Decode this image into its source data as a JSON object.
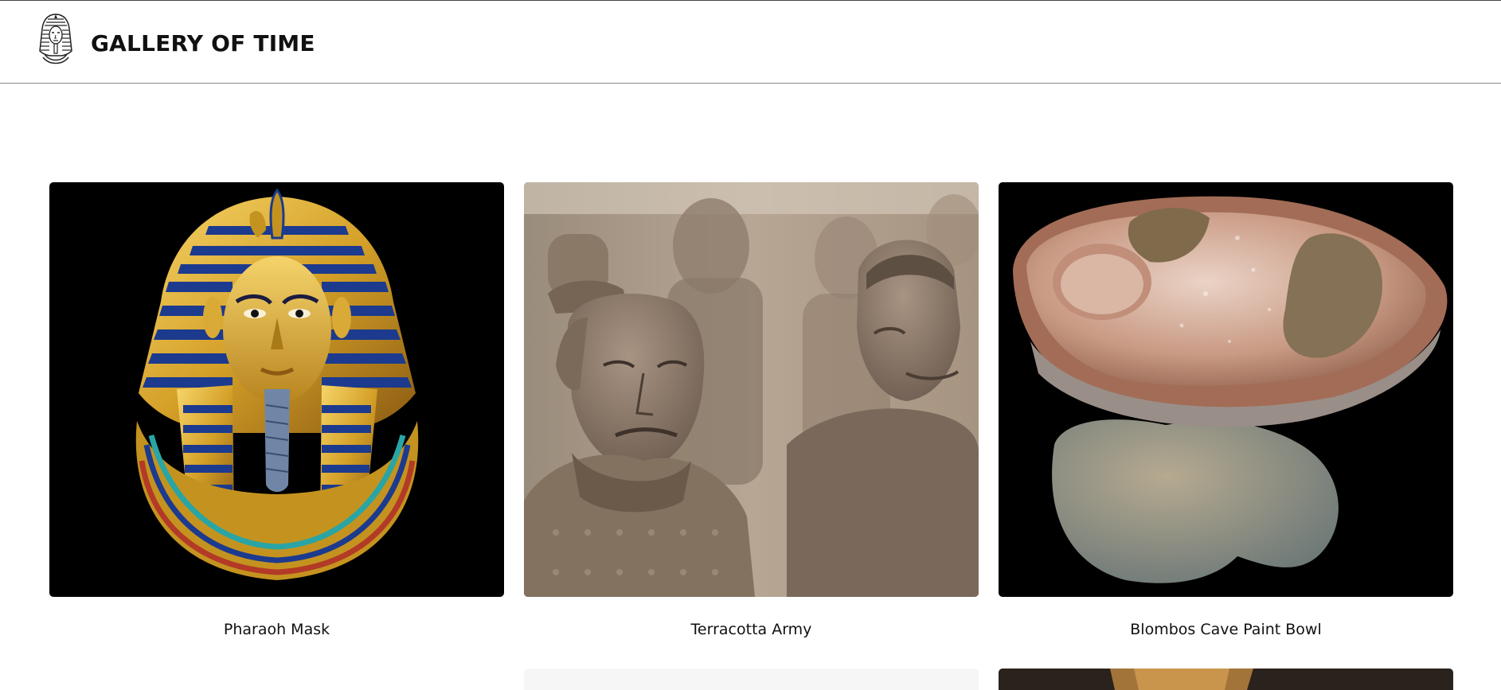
{
  "header": {
    "title": "GALLERY OF TIME",
    "logo_icon": "pharaoh-logo-icon"
  },
  "gallery": {
    "items": [
      {
        "title": "Pharaoh Mask"
      },
      {
        "title": "Terracotta Army"
      },
      {
        "title": "Blombos Cave Paint Bowl"
      }
    ]
  },
  "colors": {
    "header_border": "#8a8a8a",
    "image_black_bg": "#000000",
    "gold": "#d4a028",
    "lapis": "#1f3c8f",
    "terracotta": "#8d7a68"
  }
}
